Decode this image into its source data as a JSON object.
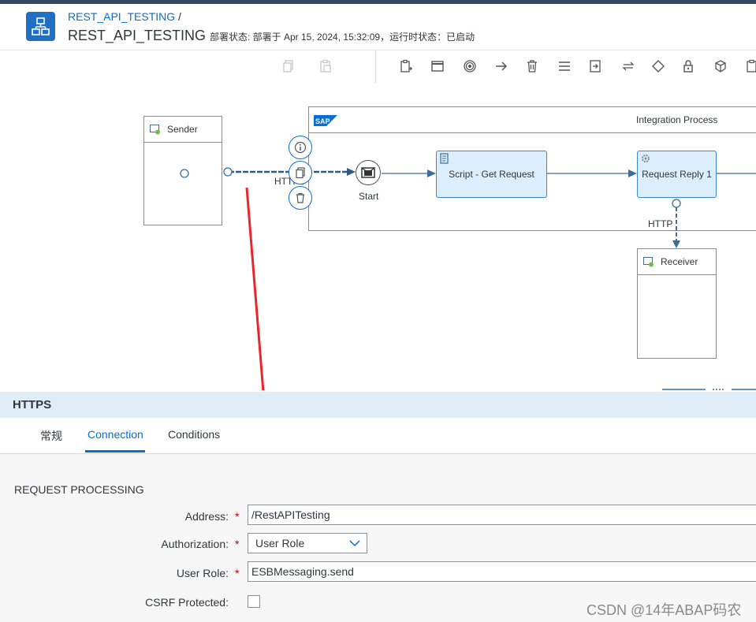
{
  "header": {
    "breadcrumb": "REST_API_TESTING",
    "breadcrumb_sep": "/",
    "title": "REST_API_TESTING",
    "status": "部署状态: 部署于 Apr 15, 2024, 15:32:09，运行时状态：已启动"
  },
  "toolbar": {
    "icons": [
      "copy-icon",
      "paste-icon",
      "add-participant-icon",
      "pool-icon",
      "event-icon",
      "connector-icon",
      "delete-icon",
      "menu-icon",
      "call-icon",
      "mapping-icon",
      "gateway-icon",
      "security-icon",
      "package-icon",
      "validate-icon"
    ]
  },
  "diagram": {
    "sender_label": "Sender",
    "integration_process_label": "Integration Process",
    "sap_logo_text": "SAP",
    "sender_connection_label": "HTTPS",
    "start_label": "Start",
    "script_step_label": "Script - Get Request",
    "request_reply_label": "Request Reply 1",
    "receiver_connection_label": "HTTP",
    "receiver_label": "Receiver"
  },
  "panel": {
    "title": "HTTPS",
    "tabs": [
      {
        "label": "常规",
        "active": false
      },
      {
        "label": "Connection",
        "active": true
      },
      {
        "label": "Conditions",
        "active": false
      }
    ],
    "section_title": "REQUEST PROCESSING",
    "fields": {
      "address_label": "Address:",
      "address_value": "/RestAPITesting",
      "authorization_label": "Authorization:",
      "authorization_value": "User Role",
      "user_role_label": "User Role:",
      "user_role_value": "ESBMessaging.send",
      "csrf_label": "CSRF Protected:",
      "csrf_checked": false,
      "required_mark": "*"
    }
  },
  "watermark": "CSDN @14年ABAP码农",
  "colors": {
    "accent": "#0a6ed1",
    "shell": "#354a5f",
    "panel_header": "#dfedf9",
    "step_fill": "#dceefb",
    "required": "#bb0000",
    "annotation_arrow": "#e8262b"
  }
}
